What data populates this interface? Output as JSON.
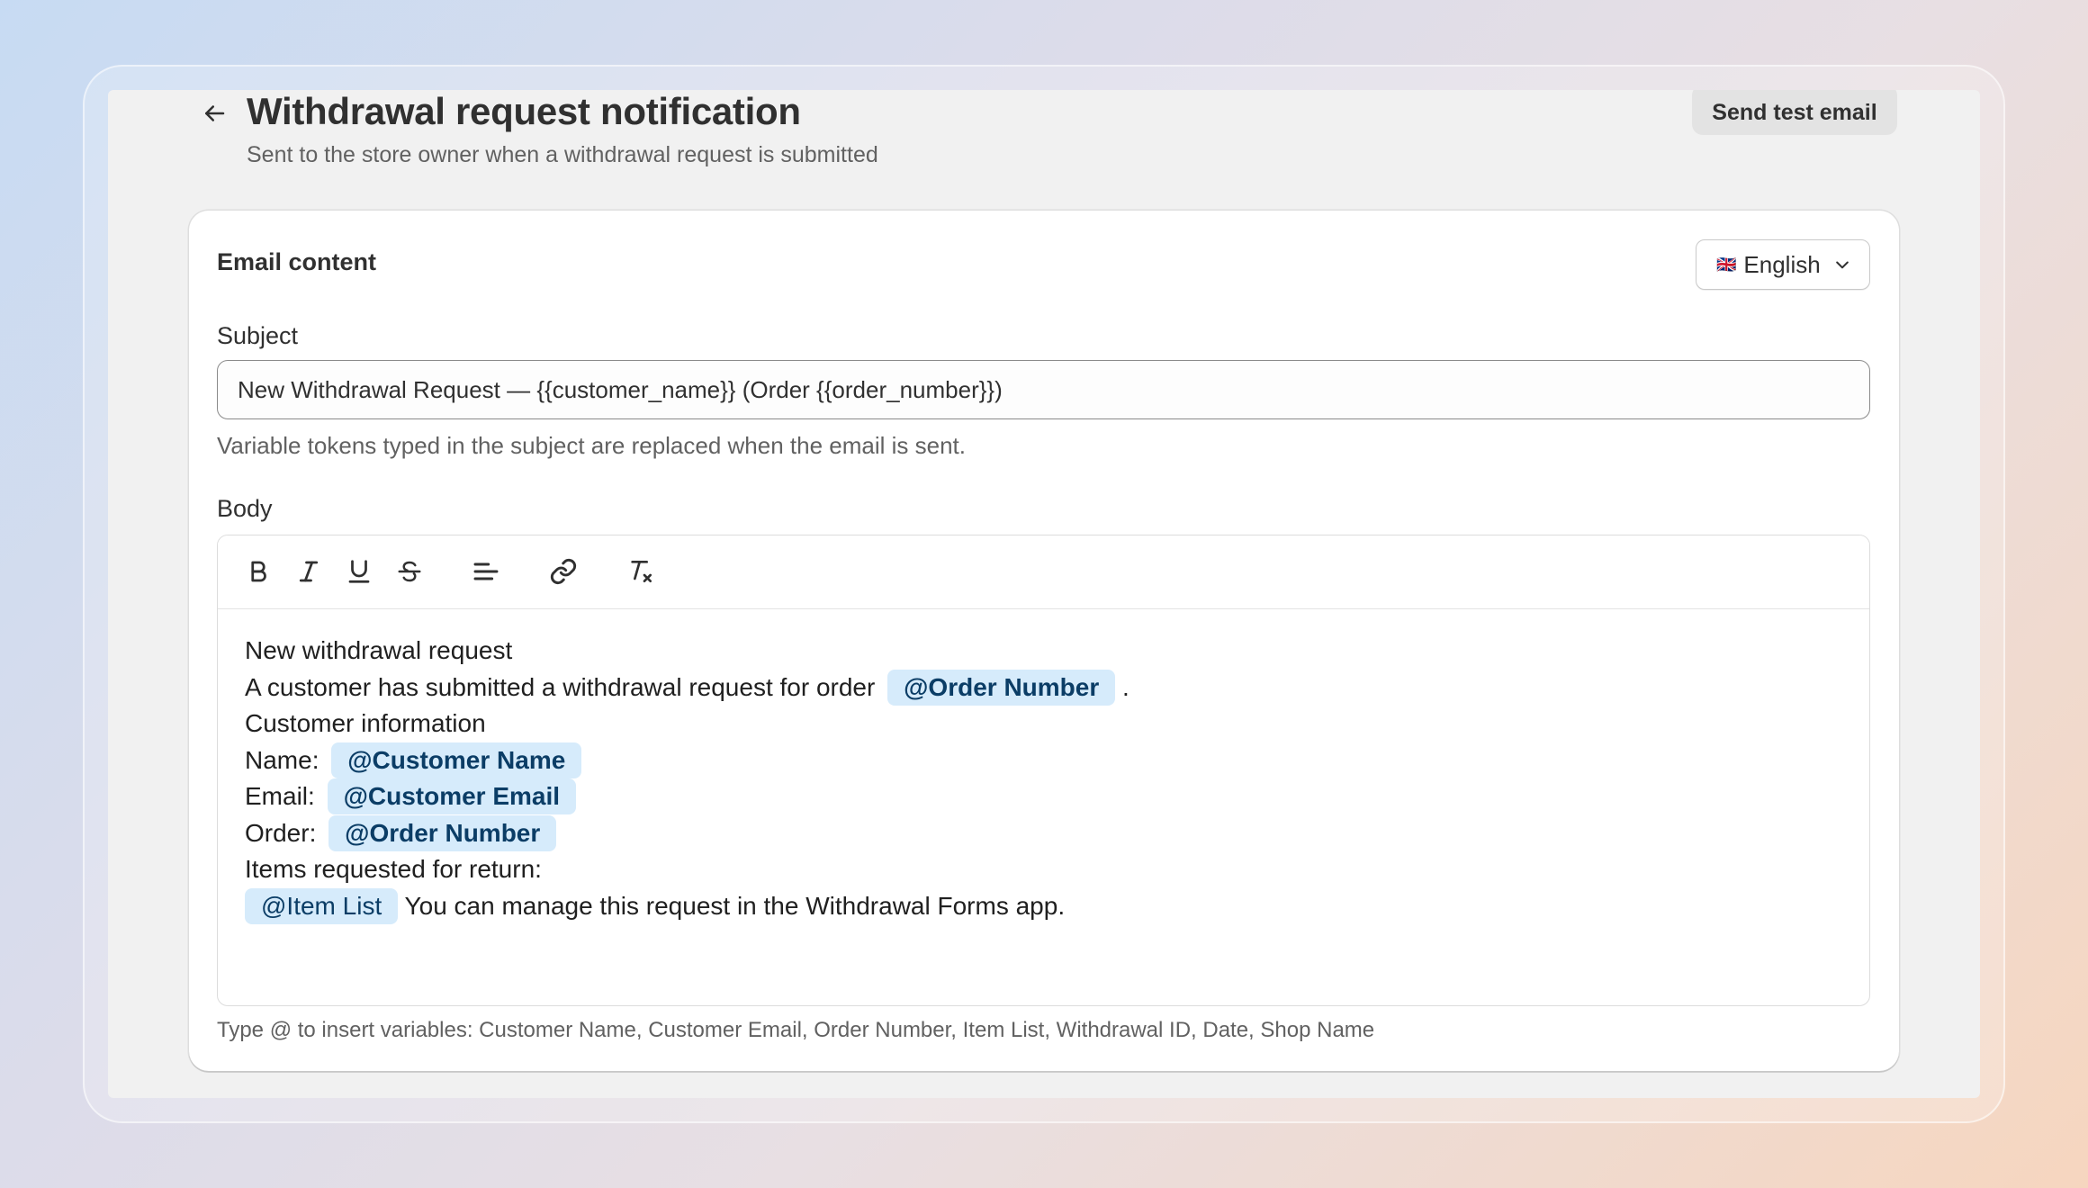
{
  "header": {
    "title": "Withdrawal request notification",
    "subtitle": "Sent to the store owner when a withdrawal request is submitted",
    "send_test_label": "Send test email"
  },
  "card": {
    "title": "Email content",
    "language": {
      "flag": "🇬🇧",
      "selected": "English"
    },
    "subject": {
      "label": "Subject",
      "value": "New Withdrawal Request — {{customer_name}} (Order {{order_number}})",
      "help": "Variable tokens typed in the subject are replaced when the email is sent."
    },
    "body": {
      "label": "Body",
      "toolbar": [
        "bold-icon",
        "italic-icon",
        "underline-icon",
        "strikethrough-icon",
        "align-left-icon",
        "link-icon",
        "clear-formatting-icon"
      ],
      "lines": {
        "l1": "New withdrawal request",
        "l2_text": "A customer has submitted a withdrawal request for order",
        "l2_token": "@Order Number",
        "l2_after": ".",
        "l3": "Customer information",
        "l4_label": "Name:",
        "l4_token": "@Customer Name",
        "l5_label": "Email:",
        "l5_token": "@Customer Email",
        "l6_label": "Order:",
        "l6_token": "@Order Number",
        "l7": "Items requested for return:",
        "l8_token": "@Item List",
        "l8_text": "You can manage this request in the Withdrawal Forms app."
      },
      "footer_help": "Type @ to insert variables: Customer Name, Customer Email, Order Number, Item List, Withdrawal ID, Date, Shop Name"
    }
  }
}
